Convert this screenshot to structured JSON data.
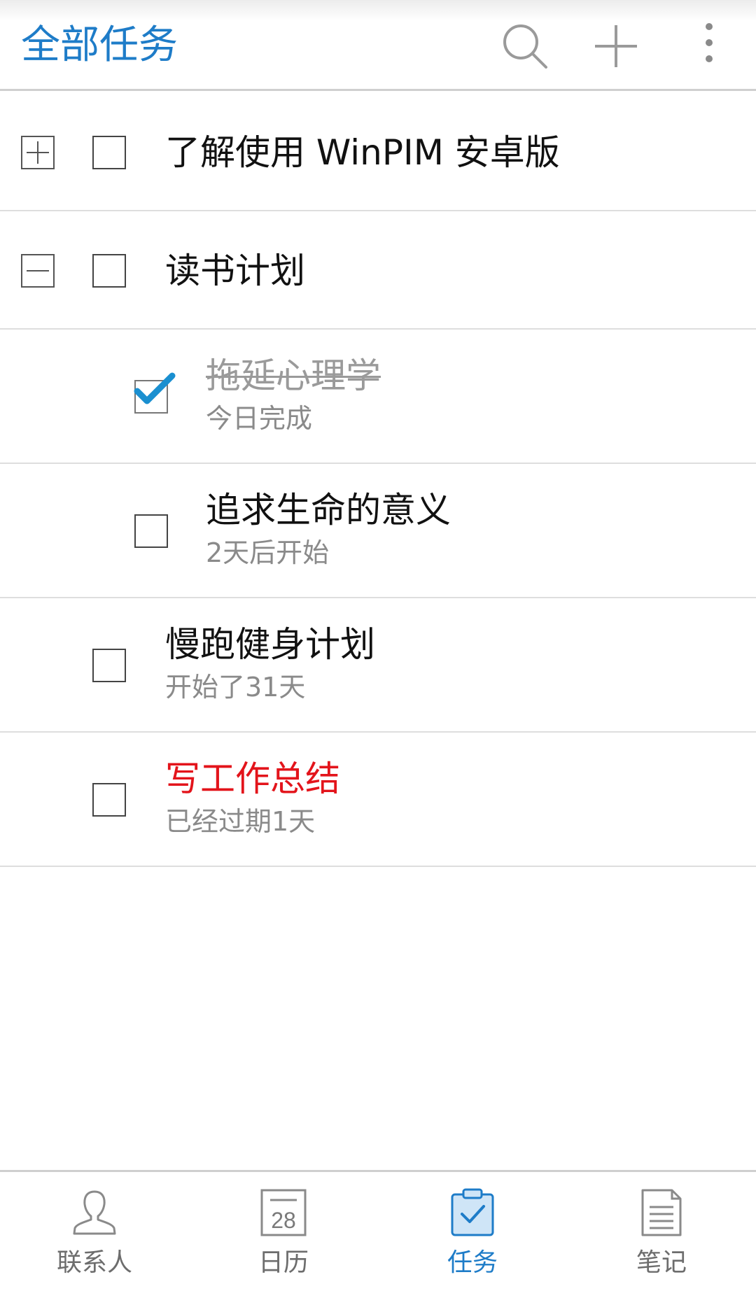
{
  "header": {
    "title": "全部任务",
    "icons": [
      "search-icon",
      "add-icon",
      "more-icon"
    ]
  },
  "tasks": [
    {
      "title": "了解使用 WinPIM 安卓版",
      "expander": "plus",
      "checked": false
    },
    {
      "title": "读书计划",
      "expander": "minus",
      "checked": false
    },
    {
      "title": "拖延心理学",
      "subtitle": "今日完成",
      "checked": true,
      "completed": true
    },
    {
      "title": "追求生命的意义",
      "subtitle": "2天后开始",
      "checked": false
    },
    {
      "title": "慢跑健身计划",
      "subtitle": "开始了31天",
      "checked": false
    },
    {
      "title": "写工作总结",
      "subtitle": "已经过期1天",
      "checked": false,
      "overdue": true
    }
  ],
  "nav": {
    "items": [
      {
        "label": "联系人",
        "icon": "contacts-icon"
      },
      {
        "label": "日历",
        "icon": "calendar-icon",
        "icon_text": "28"
      },
      {
        "label": "任务",
        "icon": "tasks-icon",
        "active": true
      },
      {
        "label": "笔记",
        "icon": "notes-icon"
      }
    ]
  },
  "colors": {
    "accent": "#1e7cc8",
    "overdue": "#e3141b",
    "check": "#1a8fd0",
    "muted_text": "#8a8a8a"
  }
}
